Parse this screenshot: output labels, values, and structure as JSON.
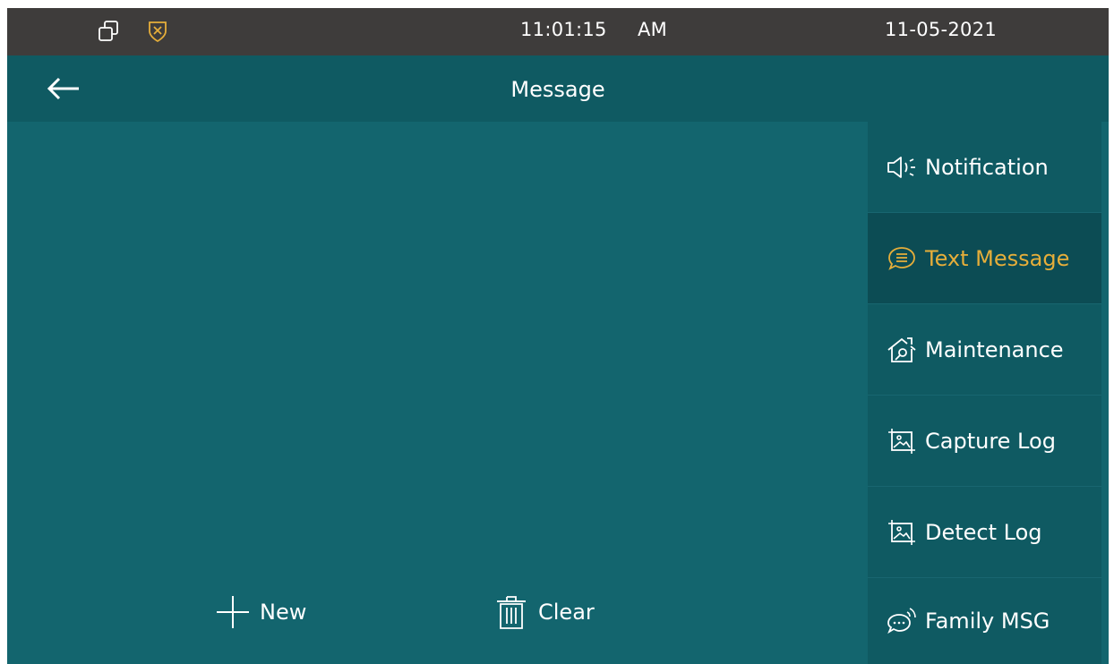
{
  "statusbar": {
    "time": "11:01:15",
    "ampm": "AM",
    "date": "11-05-2021",
    "icons": [
      "window-restore-icon",
      "shield-x-icon"
    ]
  },
  "header": {
    "title": "Message",
    "back_icon": "arrow-left-icon"
  },
  "actions": {
    "new_label": "New",
    "clear_label": "Clear"
  },
  "sidebar": {
    "items": [
      {
        "label": "Notification",
        "icon": "speaker-icon",
        "active": false
      },
      {
        "label": "Text Message",
        "icon": "chat-bubble-icon",
        "active": true
      },
      {
        "label": "Maintenance",
        "icon": "house-wrench-icon",
        "active": false
      },
      {
        "label": "Capture Log",
        "icon": "image-frame-icon",
        "active": false
      },
      {
        "label": "Detect Log",
        "icon": "image-frame-icon",
        "active": false
      },
      {
        "label": "Family MSG",
        "icon": "chat-signal-icon",
        "active": false
      }
    ]
  },
  "colors": {
    "statusbar_bg": "#3e3c3b",
    "titlebar_bg": "#0f5a62",
    "content_bg": "#13656e",
    "active_item_bg": "#0c4c54",
    "accent": "#e6ae3a"
  }
}
